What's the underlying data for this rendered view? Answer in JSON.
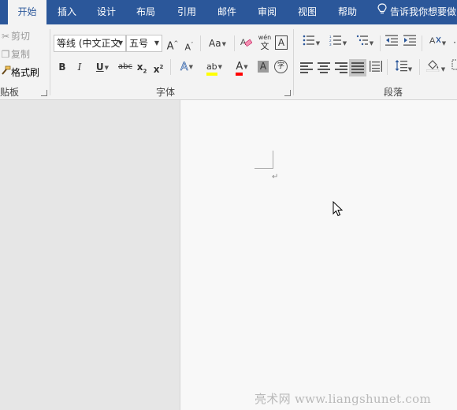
{
  "menu": {
    "tabs": [
      {
        "label": "开始",
        "active": true
      },
      {
        "label": "插入"
      },
      {
        "label": "设计"
      },
      {
        "label": "布局"
      },
      {
        "label": "引用"
      },
      {
        "label": "邮件"
      },
      {
        "label": "审阅"
      },
      {
        "label": "视图"
      },
      {
        "label": "帮助"
      }
    ],
    "tell_me": "告诉我你想要做"
  },
  "clipboard": {
    "cut": "剪切",
    "copy": "复制",
    "format_painter": "格式刷",
    "group_label": "贴板"
  },
  "font": {
    "family": "等线 (中文正文",
    "size": "五号",
    "grow": "A",
    "shrink": "A",
    "change_case": "Aa",
    "phonetic_top": "wén",
    "phonetic_bottom": "文",
    "char_border": "A",
    "bold": "B",
    "italic": "I",
    "underline": "U",
    "strike": "abc",
    "subscript": "x",
    "subscript_digit": "2",
    "superscript": "x",
    "superscript_digit": "2",
    "text_effects": "A",
    "highlight": "ab",
    "font_color": "A",
    "char_shading": "A",
    "enclose": "字",
    "group_label": "字体",
    "highlight_color": "#ffff00",
    "font_color_value": "#ff0000"
  },
  "paragraph": {
    "group_label": "段落"
  },
  "document": {
    "paragraph_mark": "↵"
  },
  "watermark": "亮术网 www.liangshunet.com"
}
